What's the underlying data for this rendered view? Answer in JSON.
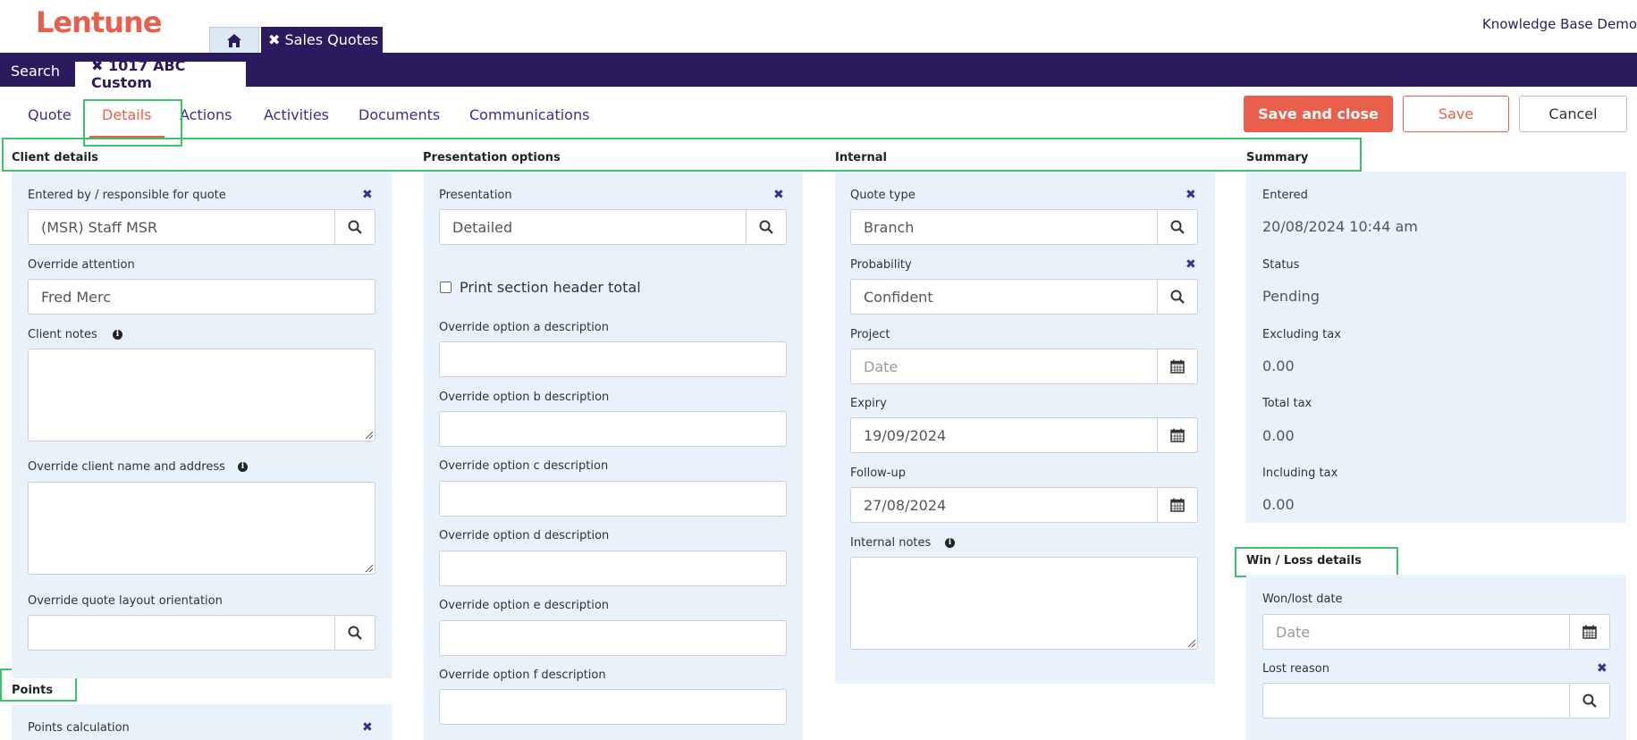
{
  "header": {
    "logo": "Lentune",
    "home_tab_icon": "home-icon",
    "sales_quotes_tab": "✖ Sales Quotes",
    "user_label": "Knowledge Base Demo"
  },
  "record_bar": {
    "search_label": "Search",
    "record_tab": "✖ 1017 ABC Custom"
  },
  "tabs": [
    "Quote",
    "Details",
    "Actions",
    "Activities",
    "Documents",
    "Communications"
  ],
  "active_tab": "Details",
  "buttons": {
    "save_and_close": "Save and close",
    "save": "Save",
    "cancel": "Cancel"
  },
  "colors": {
    "brand": "#e8604c",
    "nav": "#2b1a5e",
    "panel": "#e9f1fb",
    "highlight": "#3cc26a"
  },
  "client_details": {
    "title": "Client details",
    "entered_by_label": "Entered by / responsible for quote",
    "entered_by_value": "(MSR) Staff MSR",
    "override_attention_label": "Override attention",
    "override_attention_value": "Fred Merc",
    "client_notes_label": "Client notes",
    "override_name_label": "Override client name and address",
    "override_layout_label": "Override quote layout orientation",
    "override_layout_value": ""
  },
  "points": {
    "title": "Points",
    "calc_label": "Points calculation"
  },
  "presentation": {
    "title": "Presentation options",
    "presentation_label": "Presentation",
    "presentation_value": "Detailed",
    "print_header_total_label": "Print section header total",
    "print_header_total_checked": false,
    "option_a_label": "Override option a description",
    "option_b_label": "Override option b description",
    "option_c_label": "Override option c description",
    "option_d_label": "Override option d description",
    "option_e_label": "Override option e description",
    "option_f_label": "Override option f description"
  },
  "internal": {
    "title": "Internal",
    "quote_type_label": "Quote type",
    "quote_type_value": "Branch",
    "probability_label": "Probability",
    "probability_value": "Confident",
    "project_label": "Project",
    "project_placeholder": "Date",
    "expiry_label": "Expiry",
    "expiry_value": "19/09/2024",
    "followup_label": "Follow-up",
    "followup_value": "27/08/2024",
    "internal_notes_label": "Internal notes"
  },
  "summary": {
    "title": "Summary",
    "entered_label": "Entered",
    "entered_value": "20/08/2024 10:44 am",
    "status_label": "Status",
    "status_value": "Pending",
    "excl_tax_label": "Excluding tax",
    "excl_tax_value": "0.00",
    "total_tax_label": "Total tax",
    "total_tax_value": "0.00",
    "incl_tax_label": "Including tax",
    "incl_tax_value": "0.00"
  },
  "win_loss": {
    "title": "Win / Loss details",
    "won_lost_date_label": "Won/lost date",
    "won_lost_date_placeholder": "Date",
    "lost_reason_label": "Lost reason",
    "lost_reason_value": ""
  }
}
